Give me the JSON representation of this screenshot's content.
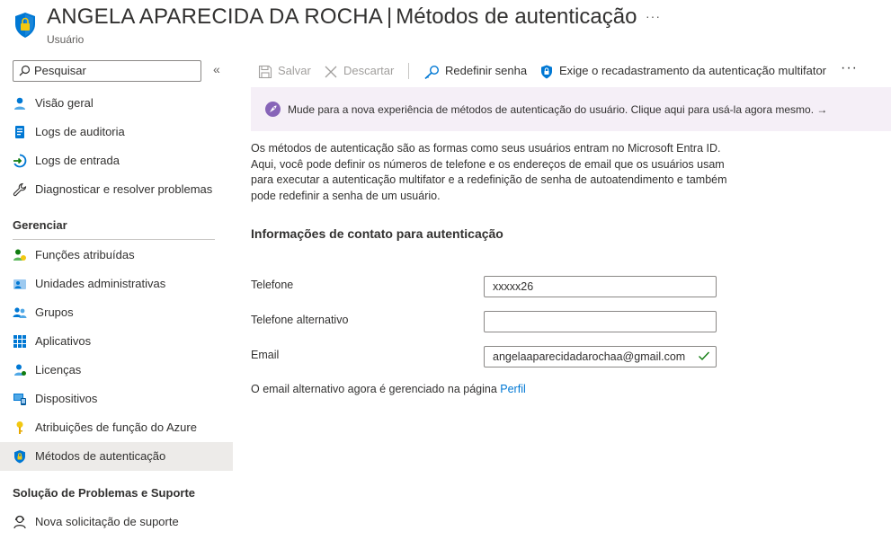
{
  "header": {
    "user_name": "ANGELA APARECIDA DA ROCHA",
    "separator": "|",
    "page": "Métodos de autenticação",
    "subtitle": "Usuário",
    "more": "···"
  },
  "sidebar": {
    "search_placeholder": "Pesquisar",
    "collapse": "«",
    "items_top": [
      {
        "label": "Visão geral",
        "icon": "user-icon"
      },
      {
        "label": "Logs de auditoria",
        "icon": "audit-log-icon"
      },
      {
        "label": "Logs de entrada",
        "icon": "sign-in-log-icon"
      },
      {
        "label": "Diagnosticar e resolver problemas",
        "icon": "wrench-icon"
      }
    ],
    "section_manage": "Gerenciar",
    "items_manage": [
      {
        "label": "Funções atribuídas",
        "icon": "roles-icon"
      },
      {
        "label": "Unidades administrativas",
        "icon": "admin-units-icon"
      },
      {
        "label": "Grupos",
        "icon": "groups-icon"
      },
      {
        "label": "Aplicativos",
        "icon": "apps-grid-icon"
      },
      {
        "label": "Licenças",
        "icon": "license-icon"
      },
      {
        "label": "Dispositivos",
        "icon": "devices-icon"
      },
      {
        "label": "Atribuições de função do Azure",
        "icon": "key-icon"
      },
      {
        "label": "Métodos de autenticação",
        "icon": "shield-icon",
        "active": true
      }
    ],
    "section_support": "Solução de Problemas e Suporte",
    "items_support": [
      {
        "label": "Nova solicitação de suporte",
        "icon": "support-icon"
      }
    ]
  },
  "toolbar": {
    "save": "Salvar",
    "discard": "Descartar",
    "reset_password": "Redefinir senha",
    "require_mfa": "Exige o recadastramento da autenticação multifator",
    "more": "···"
  },
  "banner": {
    "text": "Mude para a nova experiência de métodos de autenticação do usuário. Clique aqui para usá-la agora mesmo. →"
  },
  "main": {
    "description": "Os métodos de autenticação são as formas como seus usuários entram no Microsoft Entra ID. Aqui, você pode definir os números de telefone e os endereços de email que os usuários usam para executar a autenticação multifator e a redefinição de senha de autoatendimento e também pode redefinir a senha de um usuário.",
    "section_title": "Informações de contato para autenticação",
    "phone_label": "Telefone",
    "phone_value": "xxxxx26",
    "alt_phone_label": "Telefone alternativo",
    "alt_phone_value": "",
    "email_label": "Email",
    "email_value": "angelaaparecidadarochaa@gmail.com",
    "note_text": "O email alternativo agora é gerenciado na página ",
    "note_link": "Perfil"
  },
  "colors": {
    "accent": "#0078d4",
    "banner_bg": "#f5eff7",
    "active_nav": "#edebe9",
    "valid_check": "#107c10"
  }
}
